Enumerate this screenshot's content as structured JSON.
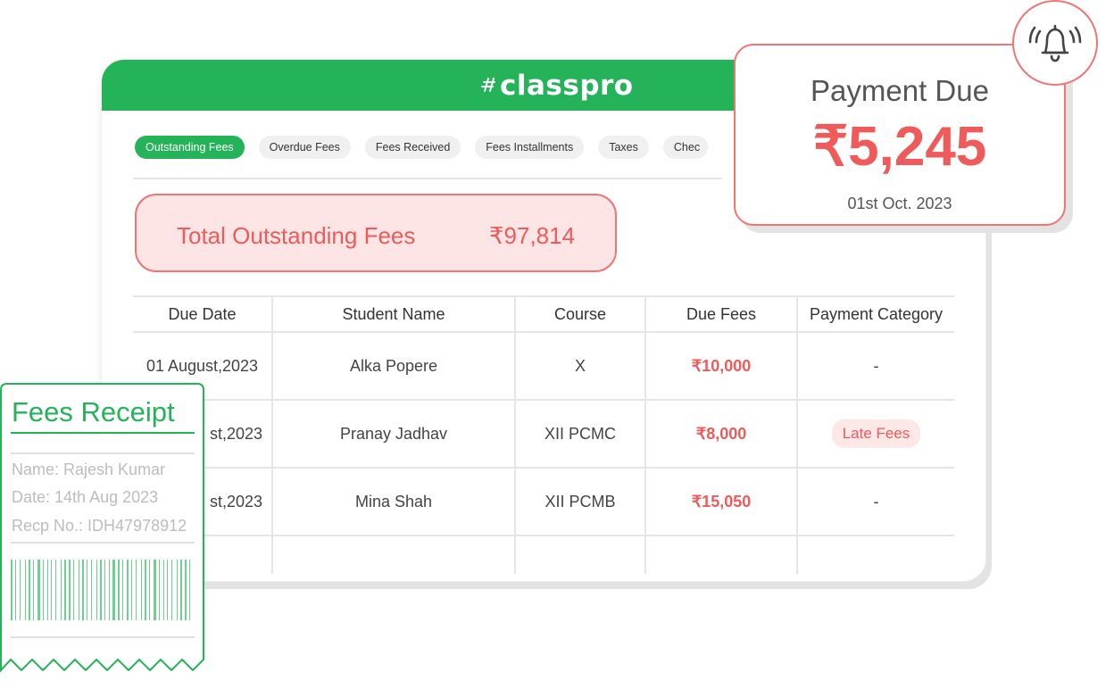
{
  "app": {
    "logo_text": "classpro",
    "tabs": [
      {
        "label": "Outstanding Fees",
        "active": true
      },
      {
        "label": "Overdue Fees",
        "active": false
      },
      {
        "label": "Fees Received",
        "active": false
      },
      {
        "label": "Fees Installments",
        "active": false
      },
      {
        "label": "Taxes",
        "active": false
      },
      {
        "label": "Chec",
        "active": false
      }
    ],
    "total": {
      "label": "Total Outstanding Fees",
      "value": "₹97,814"
    },
    "table": {
      "headers": [
        "Due Date",
        "Student Name",
        "Course",
        "Due Fees",
        "Payment Category"
      ],
      "rows": [
        {
          "date": "01 August,2023",
          "name": "Alka Popere",
          "course": "X",
          "fees": "₹10,000",
          "category": "-"
        },
        {
          "date": "st,2023",
          "name": "Pranay Jadhav",
          "course": "XII PCMC",
          "fees": "₹8,000",
          "category": "Late Fees"
        },
        {
          "date": "st,2023",
          "name": "Mina Shah",
          "course": "XII PCMB",
          "fees": "₹15,050",
          "category": "-"
        }
      ]
    }
  },
  "payment_due": {
    "title": "Payment Due",
    "amount": "₹5,245",
    "date": "01st Oct. 2023",
    "icon": "bell-icon"
  },
  "receipt": {
    "title": "Fees Receipt",
    "name": "Name: Rajesh Kumar",
    "date": "Date: 14th Aug 2023",
    "recp_no": "Recp No.: IDH47978912",
    "icon": "barcode-icon"
  },
  "colors": {
    "brand_green": "#25b35a",
    "alert_red": "#ef5a5a",
    "alert_bg": "#fde5e5"
  }
}
